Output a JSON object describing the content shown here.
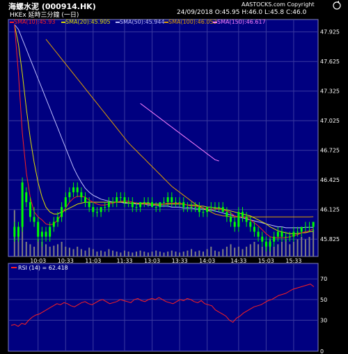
{
  "header": {
    "title": "海螺水泥 (000914.HK)",
    "source": "AASTOCKS.com Copyright",
    "subtitle": "HKEx 延時三分鐘 (一日)",
    "quote": "24/09/2018  O:45.95  H:46.0  L:45.8  C:46.0"
  },
  "colors": {
    "background": "#000000",
    "plot_bg": "#000080",
    "grid": "#3a3aa0",
    "axis_text": "#ffffff",
    "price_bar": "#00ff00",
    "sma10": "#ff2020",
    "sma20": "#e0e000",
    "sma50": "#c0c0ff",
    "sma100": "#e0a000",
    "sma150": "#ff80ff",
    "rsi": "#ff2020",
    "volume": "#808080",
    "legend_text": "#ffffff"
  },
  "chart_data": [
    {
      "type": "candlestick",
      "legend": [
        {
          "name": "SMA(10):45.93",
          "color": "#ff2020"
        },
        {
          "name": "SMA(20):45.905",
          "color": "#e0e000"
        },
        {
          "name": "SMA(50):45.944",
          "color": "#c0c0ff"
        },
        {
          "name": "SMA(100):46.052",
          "color": "#e0a000"
        },
        {
          "name": "SMA(150):46.617",
          "color": "#ff80ff"
        }
      ],
      "x_ticks": [
        "10:03",
        "10:33",
        "11:03",
        "11:33",
        "13:03",
        "13:33",
        "14:03",
        "14:33",
        "15:03",
        "15:33"
      ],
      "y_ticks": [
        "47.925",
        "47.625",
        "47.325",
        "47.025",
        "46.725",
        "46.425",
        "46.125",
        "45.825"
      ],
      "ylim": [
        45.65,
        48.05
      ],
      "bars": [
        [
          45.95,
          46.0,
          45.8,
          45.85
        ],
        [
          45.85,
          46.0,
          45.8,
          45.95
        ],
        [
          45.95,
          46.45,
          45.9,
          46.4
        ],
        [
          46.3,
          46.35,
          46.15,
          46.2
        ],
        [
          46.2,
          46.25,
          46.0,
          46.05
        ],
        [
          46.05,
          46.15,
          45.95,
          46.0
        ],
        [
          46.0,
          46.05,
          45.8,
          45.85
        ],
        [
          45.85,
          45.95,
          45.75,
          45.9
        ],
        [
          45.9,
          45.95,
          45.8,
          45.85
        ],
        [
          45.85,
          46.0,
          45.8,
          45.95
        ],
        [
          45.95,
          46.05,
          45.9,
          46.0
        ],
        [
          46.0,
          46.1,
          45.95,
          46.05
        ],
        [
          46.05,
          46.2,
          46.0,
          46.15
        ],
        [
          46.15,
          46.3,
          46.1,
          46.25
        ],
        [
          46.25,
          46.35,
          46.2,
          46.3
        ],
        [
          46.3,
          46.4,
          46.25,
          46.35
        ],
        [
          46.35,
          46.4,
          46.25,
          46.3
        ],
        [
          46.3,
          46.35,
          46.2,
          46.25
        ],
        [
          46.25,
          46.3,
          46.15,
          46.2
        ],
        [
          46.2,
          46.25,
          46.1,
          46.15
        ],
        [
          46.15,
          46.2,
          46.05,
          46.1
        ],
        [
          46.1,
          46.15,
          46.05,
          46.1
        ],
        [
          46.1,
          46.15,
          46.05,
          46.15
        ],
        [
          46.15,
          46.2,
          46.1,
          46.15
        ],
        [
          46.15,
          46.25,
          46.1,
          46.2
        ],
        [
          46.2,
          46.25,
          46.15,
          46.2
        ],
        [
          46.2,
          46.3,
          46.15,
          46.25
        ],
        [
          46.25,
          46.3,
          46.2,
          46.25
        ],
        [
          46.25,
          46.3,
          46.15,
          46.2
        ],
        [
          46.2,
          46.25,
          46.15,
          46.2
        ],
        [
          46.2,
          46.25,
          46.1,
          46.15
        ],
        [
          46.15,
          46.2,
          46.1,
          46.15
        ],
        [
          46.15,
          46.2,
          46.1,
          46.2
        ],
        [
          46.2,
          46.25,
          46.15,
          46.2
        ],
        [
          46.2,
          46.25,
          46.15,
          46.2
        ],
        [
          46.2,
          46.25,
          46.15,
          46.15
        ],
        [
          46.15,
          46.2,
          46.1,
          46.15
        ],
        [
          46.15,
          46.2,
          46.1,
          46.2
        ],
        [
          46.2,
          46.25,
          46.15,
          46.2
        ],
        [
          46.2,
          46.3,
          46.15,
          46.25
        ],
        [
          46.25,
          46.3,
          46.15,
          46.2
        ],
        [
          46.2,
          46.25,
          46.15,
          46.2
        ],
        [
          46.2,
          46.25,
          46.15,
          46.2
        ],
        [
          46.2,
          46.25,
          46.1,
          46.15
        ],
        [
          46.15,
          46.2,
          46.1,
          46.15
        ],
        [
          46.15,
          46.2,
          46.1,
          46.15
        ],
        [
          46.15,
          46.2,
          46.1,
          46.15
        ],
        [
          46.15,
          46.2,
          46.05,
          46.1
        ],
        [
          46.1,
          46.15,
          46.05,
          46.1
        ],
        [
          46.1,
          46.15,
          46.05,
          46.15
        ],
        [
          46.15,
          46.2,
          46.1,
          46.15
        ],
        [
          46.15,
          46.2,
          46.1,
          46.15
        ],
        [
          46.15,
          46.2,
          46.1,
          46.15
        ],
        [
          46.15,
          46.2,
          46.1,
          46.1
        ],
        [
          46.1,
          46.15,
          46.0,
          46.05
        ],
        [
          46.05,
          46.1,
          45.95,
          46.0
        ],
        [
          46.0,
          46.05,
          45.9,
          45.95
        ],
        [
          45.95,
          46.15,
          45.9,
          46.1
        ],
        [
          46.1,
          46.15,
          46.0,
          46.05
        ],
        [
          46.05,
          46.1,
          45.95,
          46.0
        ],
        [
          46.0,
          46.05,
          45.9,
          45.95
        ],
        [
          45.95,
          46.0,
          45.85,
          45.9
        ],
        [
          45.9,
          45.95,
          45.8,
          45.85
        ],
        [
          45.85,
          45.9,
          45.75,
          45.8
        ],
        [
          45.8,
          45.85,
          45.7,
          45.75
        ],
        [
          45.75,
          45.85,
          45.7,
          45.8
        ],
        [
          45.8,
          45.9,
          45.75,
          45.85
        ],
        [
          45.85,
          45.95,
          45.8,
          45.9
        ],
        [
          45.9,
          45.95,
          45.8,
          45.85
        ],
        [
          45.85,
          45.9,
          45.8,
          45.85
        ],
        [
          45.85,
          45.9,
          45.8,
          45.85
        ],
        [
          45.85,
          45.95,
          45.8,
          45.9
        ],
        [
          45.9,
          45.95,
          45.85,
          45.9
        ],
        [
          45.9,
          45.95,
          45.85,
          45.95
        ],
        [
          45.95,
          46.0,
          45.9,
          45.95
        ],
        [
          45.95,
          46.0,
          45.9,
          45.95
        ],
        [
          45.95,
          46.0,
          45.9,
          46.0
        ]
      ],
      "sma10": [
        48.0,
        47.5,
        46.9,
        46.5,
        46.25,
        46.1,
        46.05,
        46.02,
        45.98,
        45.97,
        45.98,
        46.02,
        46.08,
        46.14,
        46.2,
        46.24,
        46.26,
        46.26,
        46.25,
        46.22,
        46.2,
        46.18,
        46.17,
        46.17,
        46.18,
        46.19,
        46.2,
        46.21,
        46.21,
        46.21,
        46.2,
        46.19,
        46.18,
        46.18,
        46.18,
        46.18,
        46.17,
        46.17,
        46.18,
        46.19,
        46.19,
        46.19,
        46.19,
        46.18,
        46.17,
        46.16,
        46.16,
        46.15,
        46.14,
        46.13,
        46.13,
        46.13,
        46.13,
        46.12,
        46.11,
        46.09,
        46.06,
        46.05,
        46.05,
        46.04,
        46.02,
        45.99,
        45.96,
        45.92,
        45.88,
        45.85,
        45.84,
        45.84,
        45.84,
        45.84,
        45.85,
        45.86,
        45.87,
        45.89,
        45.9,
        45.91,
        45.93
      ],
      "sma20": [
        48.0,
        47.8,
        47.5,
        47.15,
        46.85,
        46.6,
        46.4,
        46.25,
        46.15,
        46.1,
        46.08,
        46.08,
        46.1,
        46.12,
        46.14,
        46.16,
        46.18,
        46.19,
        46.2,
        46.2,
        46.2,
        46.2,
        46.2,
        46.2,
        46.2,
        46.2,
        46.2,
        46.2,
        46.2,
        46.19,
        46.19,
        46.19,
        46.19,
        46.19,
        46.19,
        46.18,
        46.18,
        46.18,
        46.18,
        46.18,
        46.18,
        46.18,
        46.18,
        46.18,
        46.17,
        46.17,
        46.17,
        46.16,
        46.16,
        46.15,
        46.15,
        46.14,
        46.14,
        46.13,
        46.12,
        46.11,
        46.1,
        46.09,
        46.08,
        46.07,
        46.06,
        46.04,
        46.02,
        46.0,
        45.98,
        45.95,
        45.93,
        45.91,
        45.9,
        45.89,
        45.88,
        45.88,
        45.88,
        45.89,
        45.89,
        45.9,
        45.905
      ],
      "sma50": [
        48.0,
        47.95,
        47.85,
        47.75,
        47.65,
        47.55,
        47.45,
        47.35,
        47.25,
        47.15,
        47.05,
        46.95,
        46.85,
        46.75,
        46.65,
        46.55,
        46.47,
        46.4,
        46.34,
        46.3,
        46.27,
        46.25,
        46.23,
        46.22,
        46.21,
        46.2,
        46.2,
        46.2,
        46.19,
        46.19,
        46.19,
        46.18,
        46.18,
        46.18,
        46.17,
        46.17,
        46.17,
        46.16,
        46.16,
        46.16,
        46.15,
        46.15,
        46.15,
        46.14,
        46.14,
        46.14,
        46.13,
        46.13,
        46.13,
        46.12,
        46.12,
        46.11,
        46.1,
        46.09,
        46.08,
        46.07,
        46.06,
        46.05,
        46.04,
        46.03,
        46.02,
        46.01,
        46.0,
        45.99,
        45.98,
        45.97,
        45.96,
        45.95,
        45.95,
        45.94,
        45.94,
        45.94,
        45.94,
        45.94,
        45.944,
        45.944,
        45.944
      ],
      "sma100_start": 8,
      "sma100": [
        47.85,
        47.8,
        47.75,
        47.7,
        47.65,
        47.6,
        47.55,
        47.5,
        47.45,
        47.4,
        47.35,
        47.3,
        47.25,
        47.2,
        47.15,
        47.1,
        47.05,
        47.0,
        46.95,
        46.9,
        46.85,
        46.8,
        46.76,
        46.72,
        46.68,
        46.64,
        46.6,
        46.56,
        46.52,
        46.48,
        46.44,
        46.4,
        46.36,
        46.33,
        46.3,
        46.27,
        46.24,
        46.21,
        46.18,
        46.16,
        46.14,
        46.12,
        46.1,
        46.08,
        46.07,
        46.06,
        46.06,
        46.05,
        46.05,
        46.05,
        46.05,
        46.05,
        46.05,
        46.05,
        46.05,
        46.05,
        46.05,
        46.05,
        46.05,
        46.05,
        46.05,
        46.05,
        46.05,
        46.05,
        46.05,
        46.05,
        46.05,
        46.05,
        46.052
      ],
      "sma150_start": 32,
      "sma150": [
        47.2,
        47.17,
        47.14,
        47.11,
        47.08,
        47.05,
        47.02,
        46.99,
        46.96,
        46.93,
        46.9,
        46.87,
        46.84,
        46.81,
        46.78,
        46.75,
        46.72,
        46.69,
        46.66,
        46.63,
        46.617
      ],
      "volume": [
        0.95,
        0.55,
        0.8,
        0.3,
        0.25,
        0.2,
        0.35,
        0.3,
        0.25,
        0.2,
        0.22,
        0.25,
        0.3,
        0.2,
        0.18,
        0.15,
        0.2,
        0.15,
        0.12,
        0.18,
        0.15,
        0.1,
        0.12,
        0.1,
        0.15,
        0.12,
        0.1,
        0.08,
        0.12,
        0.1,
        0.08,
        0.1,
        0.12,
        0.1,
        0.08,
        0.1,
        0.12,
        0.1,
        0.08,
        0.1,
        0.12,
        0.1,
        0.08,
        0.1,
        0.12,
        0.15,
        0.1,
        0.12,
        0.1,
        0.15,
        0.2,
        0.12,
        0.1,
        0.15,
        0.2,
        0.25,
        0.18,
        0.2,
        0.15,
        0.2,
        0.25,
        0.3,
        0.25,
        0.2,
        0.25,
        0.35,
        0.2,
        0.25,
        0.3,
        0.35,
        0.25,
        0.3,
        0.35,
        0.4,
        0.35,
        0.4,
        0.55
      ]
    },
    {
      "type": "line",
      "legend": [
        {
          "name": "RSI (14) = 62.418",
          "color": "#ff2020"
        }
      ],
      "y_ticks": [
        "70",
        "50",
        "30",
        "0"
      ],
      "ylim": [
        0,
        85
      ],
      "values": [
        25,
        26,
        24,
        27,
        26,
        30,
        33,
        35,
        36,
        38,
        40,
        42,
        44,
        46,
        45,
        47,
        46,
        44,
        43,
        45,
        47,
        48,
        46,
        45,
        47,
        49,
        50,
        48,
        46,
        47,
        48,
        50,
        49,
        48,
        47,
        50,
        51,
        49,
        48,
        50,
        51,
        50,
        52,
        50,
        48,
        47,
        46,
        48,
        50,
        49,
        51,
        50,
        48,
        47,
        49,
        46,
        45,
        44,
        40,
        38,
        36,
        34,
        30,
        28,
        32,
        34,
        37,
        39,
        41,
        43,
        44,
        45,
        47,
        49,
        50,
        52,
        54,
        55,
        56,
        58,
        60,
        61,
        62,
        63,
        64,
        65,
        62.418
      ]
    }
  ]
}
